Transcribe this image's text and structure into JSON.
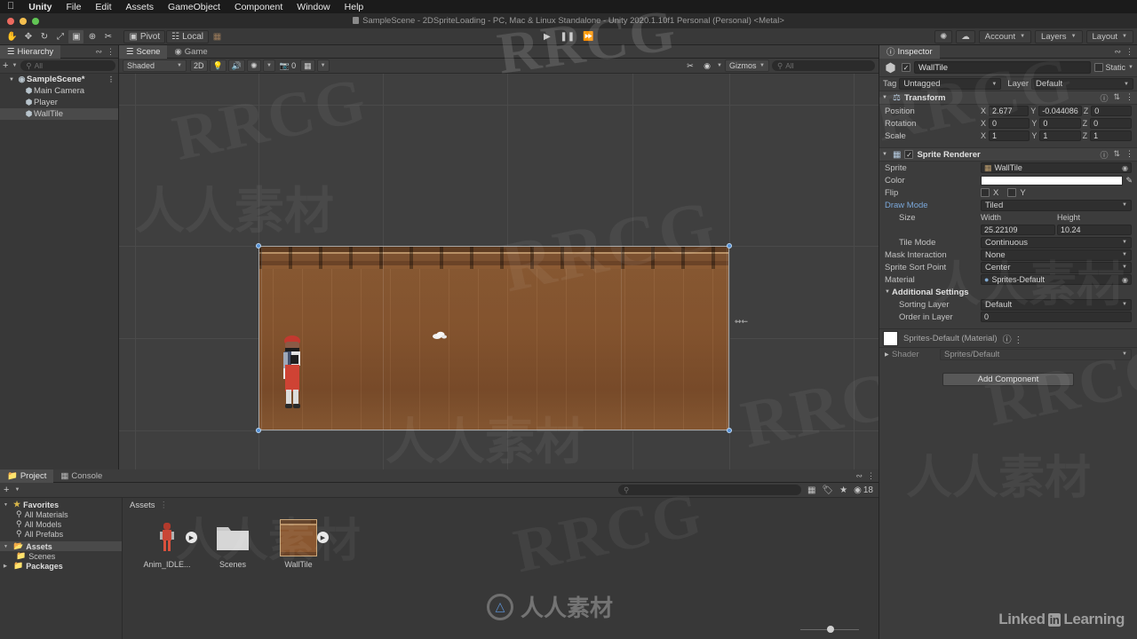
{
  "macbar": {
    "apple_icon": "apple-icon",
    "items": [
      "Unity",
      "File",
      "Edit",
      "Assets",
      "GameObject",
      "Component",
      "Window",
      "Help"
    ]
  },
  "titlebar": {
    "title": "SampleScene - 2DSpriteLoading - PC, Mac & Linux Standalone - Unity 2020.1.10f1 Personal (Personal) <Metal>"
  },
  "toolbar": {
    "tools": [
      {
        "name": "hand-tool-icon",
        "glyph": "✋"
      },
      {
        "name": "move-tool-icon",
        "glyph": "✥"
      },
      {
        "name": "rotate-tool-icon",
        "glyph": "↻"
      },
      {
        "name": "scale-tool-icon",
        "glyph": "⤢"
      },
      {
        "name": "rect-tool-icon",
        "glyph": "▣"
      },
      {
        "name": "transform-tool-icon",
        "glyph": "⊕"
      },
      {
        "name": "custom-tool-icon",
        "glyph": "✂"
      }
    ],
    "pivot_label": "Pivot",
    "local_label": "Local",
    "snap_icon": "grid-snap-icon",
    "play_icon": "play-icon",
    "pause_icon": "pause-icon",
    "step_icon": "step-icon",
    "collab_label": "Collab",
    "cloud_icon": "cloud-icon",
    "account_label": "Account",
    "layers_label": "Layers",
    "layout_label": "Layout"
  },
  "hierarchy": {
    "tab_label": "Hierarchy",
    "search_placeholder": "All",
    "add_label": "+",
    "items": [
      {
        "label": "SampleScene*",
        "depth": 0,
        "icon": "scene-icon",
        "selected": false,
        "expanded": true
      },
      {
        "label": "Main Camera",
        "depth": 1,
        "icon": "gameobject-icon",
        "selected": false
      },
      {
        "label": "Player",
        "depth": 1,
        "icon": "gameobject-icon",
        "selected": false
      },
      {
        "label": "WallTile",
        "depth": 1,
        "icon": "gameobject-icon",
        "selected": true
      }
    ]
  },
  "scene": {
    "tabs": [
      {
        "label": "Scene",
        "icon": "scene-tab-icon",
        "active": true
      },
      {
        "label": "Game",
        "icon": "game-tab-icon",
        "active": false
      }
    ],
    "shading_mode": "Shaded",
    "mode_2d": "2D",
    "lighting_icon": "light-icon",
    "audio_icon": "audio-icon",
    "fx_icon": "fx-icon",
    "camera_count": "0",
    "grid_icon": "grid-icon",
    "tools_icon": "scene-tools-icon",
    "visibility_icon": "visibility-icon",
    "gizmos_label": "Gizmos",
    "search_placeholder": "All"
  },
  "inspector": {
    "tab_label": "Inspector",
    "object": {
      "name": "WallTile",
      "enabled": true,
      "static_label": "Static",
      "tag_label": "Tag",
      "tag_value": "Untagged",
      "layer_label": "Layer",
      "layer_value": "Default"
    },
    "transform": {
      "title": "Transform",
      "rows": [
        {
          "label": "Position",
          "x": "2.677",
          "y": "-0.044086",
          "z": "0"
        },
        {
          "label": "Rotation",
          "x": "0",
          "y": "0",
          "z": "0"
        },
        {
          "label": "Scale",
          "x": "1",
          "y": "1",
          "z": "1"
        }
      ],
      "axis_labels": [
        "X",
        "Y",
        "Z"
      ]
    },
    "sprite_renderer": {
      "title": "Sprite Renderer",
      "enabled": true,
      "sprite_label": "Sprite",
      "sprite_value": "WallTile",
      "color_label": "Color",
      "color_value": "#FFFFFF",
      "flip_label": "Flip",
      "flip_x": "X",
      "flip_y": "Y",
      "draw_mode_label": "Draw Mode",
      "draw_mode_value": "Tiled",
      "size_label": "Size",
      "width_label": "Width",
      "height_label": "Height",
      "width_value": "25.22109",
      "height_value": "10.24",
      "tile_mode_label": "Tile Mode",
      "tile_mode_value": "Continuous",
      "mask_interaction_label": "Mask Interaction",
      "mask_interaction_value": "None",
      "sprite_sort_point_label": "Sprite Sort Point",
      "sprite_sort_point_value": "Center",
      "material_label": "Material",
      "material_value": "Sprites-Default",
      "additional_settings_label": "Additional Settings",
      "sorting_layer_label": "Sorting Layer",
      "sorting_layer_value": "Default",
      "order_in_layer_label": "Order in Layer",
      "order_in_layer_value": "0"
    },
    "material": {
      "title": "Sprites-Default (Material)",
      "shader_label": "Shader",
      "shader_value": "Sprites/Default"
    },
    "add_component_label": "Add Component"
  },
  "project": {
    "tabs": [
      {
        "label": "Project",
        "icon": "project-tab-icon",
        "active": true
      },
      {
        "label": "Console",
        "icon": "console-tab-icon",
        "active": false
      }
    ],
    "add_label": "+",
    "search_placeholder": "",
    "badge_count": "18",
    "tree": [
      {
        "label": "Favorites",
        "depth": 0,
        "icon": "star-icon",
        "bold": true,
        "expanded": true
      },
      {
        "label": "All Materials",
        "depth": 1,
        "icon": "search-icon"
      },
      {
        "label": "All Models",
        "depth": 1,
        "icon": "search-icon"
      },
      {
        "label": "All Prefabs",
        "depth": 1,
        "icon": "search-icon"
      },
      {
        "label": "Assets",
        "depth": 0,
        "icon": "folder-open-icon",
        "bold": true,
        "selected": true,
        "expanded": true
      },
      {
        "label": "Scenes",
        "depth": 1,
        "icon": "folder-icon"
      },
      {
        "label": "Packages",
        "depth": 0,
        "icon": "folder-icon",
        "bold": true,
        "expanded": false
      }
    ],
    "breadcrumb": "Assets",
    "assets": [
      {
        "label": "Anim_IDLE...",
        "kind": "sprite-sheet",
        "has_expand": true
      },
      {
        "label": "Scenes",
        "kind": "folder",
        "has_expand": false
      },
      {
        "label": "WallTile",
        "kind": "texture",
        "has_expand": true
      }
    ]
  },
  "watermarks": {
    "brand": "RRCG",
    "cn": "人人素材",
    "linkedin": "Linked",
    "linkedin_in": "in",
    "linkedin_learning": "Learning"
  }
}
